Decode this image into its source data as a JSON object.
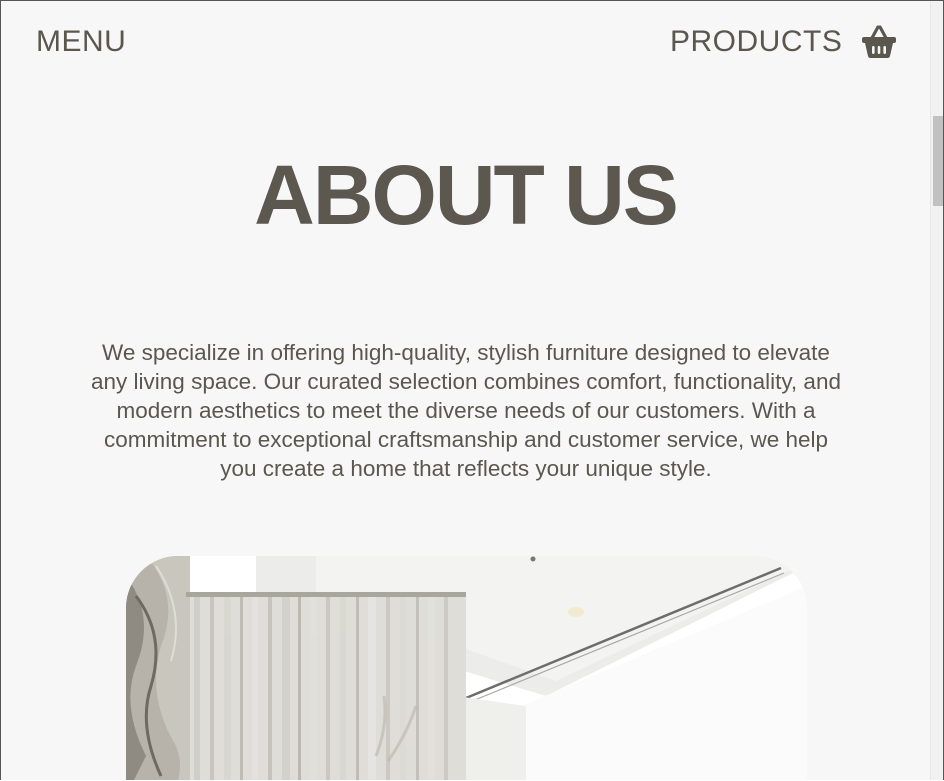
{
  "nav": {
    "menu_label": "MENU",
    "products_label": "PRODUCTS",
    "cart_icon": "shopping-basket-icon"
  },
  "hero": {
    "title": "ABOUT US",
    "description": "We specialize in offering high-quality, stylish furniture designed to elevate any living space. Our curated selection combines comfort, functionality, and modern aesthetics to meet the diverse needs of our customers. With a commitment to exceptional craftsmanship and customer service, we help you create a home that reflects your unique style."
  },
  "colors": {
    "text": "#5b574f",
    "background": "#f7f7f7"
  }
}
